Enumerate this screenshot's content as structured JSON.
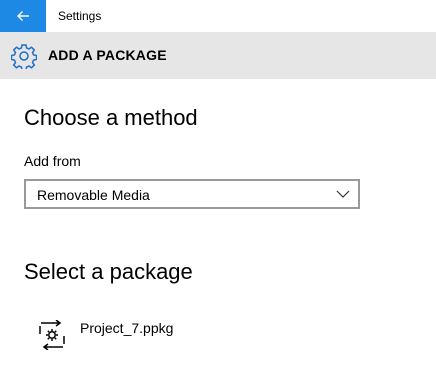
{
  "window": {
    "app_title": "Settings",
    "back_icon": "back-arrow-icon",
    "accent": "#1e88e5"
  },
  "header": {
    "title": "ADD A PACKAGE",
    "icon": "gear-icon",
    "background": "#e6e6e6"
  },
  "method": {
    "heading": "Choose a method",
    "add_from_label": "Add from",
    "selected": "Removable Media"
  },
  "package": {
    "heading": "Select a package",
    "items": [
      {
        "name": "Project_7.ppkg",
        "icon": "provisioning-package-icon"
      }
    ]
  }
}
